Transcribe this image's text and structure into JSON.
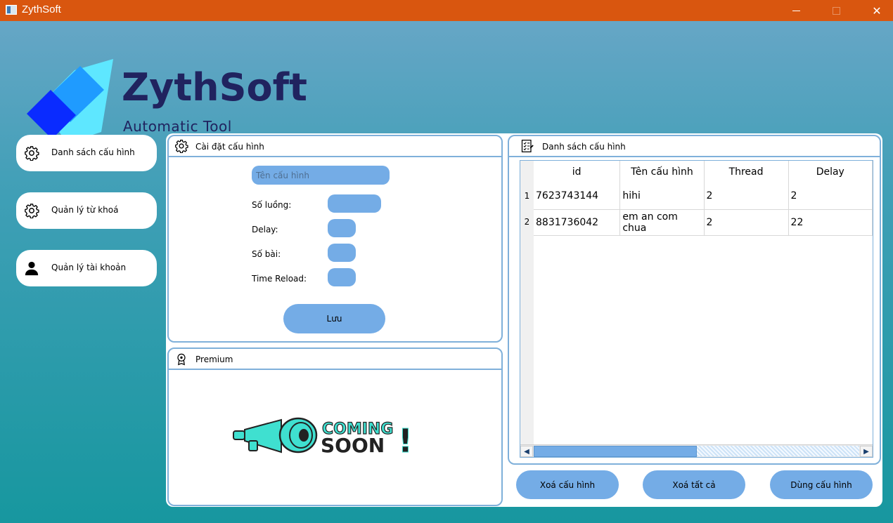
{
  "window": {
    "title": "ZythSoft",
    "controls": [
      "minimize",
      "maximize",
      "close"
    ],
    "close_glyph": "✕"
  },
  "brand": {
    "name": "ZythSoft",
    "tagline": "Automatic Tool",
    "colors": {
      "dark": "#20235f",
      "blue": "#1f9bff",
      "deep_blue": "#0a2bff",
      "cyan": "#5ee7ff"
    }
  },
  "nav": {
    "items": [
      {
        "label": "Danh sách cấu hình",
        "icon": "gear-icon"
      },
      {
        "label": "Quản lý từ khoá",
        "icon": "gear-icon"
      },
      {
        "label": "Quản lý tài khoản",
        "icon": "user-icon"
      }
    ]
  },
  "config_panel": {
    "title": "Cài đặt cấu hình",
    "icon": "gear-icon",
    "name_placeholder": "Tên cấu hình",
    "fields": [
      {
        "label": "Số luồng:",
        "value": ""
      },
      {
        "label": "Delay:",
        "value": ""
      },
      {
        "label": "Số bài:",
        "value": ""
      },
      {
        "label": "Time Reload:",
        "value": ""
      }
    ],
    "save_label": "Lưu"
  },
  "premium_panel": {
    "title": "Premium",
    "icon": "award-icon",
    "coming_soon_line1": "COMING",
    "coming_soon_line2": "SOON",
    "coming_soon_mark": "!"
  },
  "list_panel": {
    "title": "Danh sách cấu hình",
    "icon": "checklist-icon",
    "columns": [
      "id",
      "Tên cấu hình",
      "Thread",
      "Delay"
    ],
    "rows": [
      {
        "num": "1",
        "cells": [
          "7623743144",
          "hihi",
          "2",
          "2"
        ]
      },
      {
        "num": "2",
        "cells": [
          "8831736042",
          "em an com chua",
          "2",
          "22"
        ]
      }
    ],
    "scroll": {
      "left_arrow": "◀",
      "right_arrow": "▶"
    }
  },
  "actions": {
    "delete_label": "Xoá cấu hình",
    "delete_all_label": "Xoá tất cả",
    "use_label": "Dùng cấu hình"
  },
  "colors": {
    "titlebar": "#d9560f",
    "accent": "#74ace6",
    "border": "#7fb0da"
  }
}
